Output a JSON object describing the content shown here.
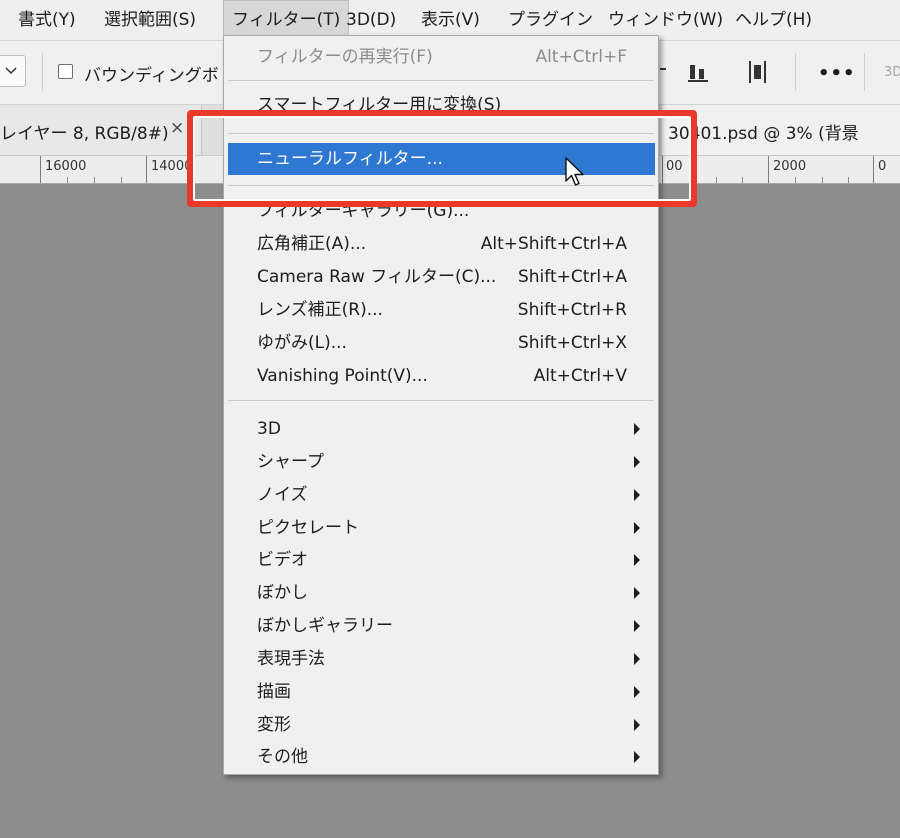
{
  "menubar": {
    "items": [
      "書式(Y)",
      "選択範囲(S)",
      "フィルター(T)",
      "3D(D)",
      "表示(V)",
      "プラグイン",
      "ウィンドウ(W)",
      "ヘルプ(H)"
    ]
  },
  "options": {
    "bounding_box_label": "バウンディングボ",
    "more_label": "•••",
    "three_d_label": "3D"
  },
  "tabs": {
    "left_title": "レイヤー 8, RGB/8#)",
    "left_close": "×",
    "right_title": "30401.psd @ 3% (背景"
  },
  "ruler": {
    "labels": [
      "16000",
      "14000",
      "00",
      "2000",
      "0"
    ]
  },
  "filter_menu": {
    "last_filter": {
      "label": "フィルターの再実行(F)",
      "shortcut": "Alt+Ctrl+F"
    },
    "smart_filter": {
      "label": "スマートフィルター用に変換(S)"
    },
    "neural_filters": {
      "label": "ニューラルフィルター..."
    },
    "filter_gallery": {
      "label": "フィルターギャラリー(G)..."
    },
    "adaptive_wide_angle": {
      "label": "広角補正(A)...",
      "shortcut": "Alt+Shift+Ctrl+A"
    },
    "camera_raw": {
      "label": "Camera Raw フィルター(C)...",
      "shortcut": "Shift+Ctrl+A"
    },
    "lens_correction": {
      "label": "レンズ補正(R)...",
      "shortcut": "Shift+Ctrl+R"
    },
    "liquify": {
      "label": "ゆがみ(L)...",
      "shortcut": "Shift+Ctrl+X"
    },
    "vanishing_point": {
      "label": "Vanishing Point(V)...",
      "shortcut": "Alt+Ctrl+V"
    },
    "submenus": [
      "3D",
      "シャープ",
      "ノイズ",
      "ピクセレート",
      "ビデオ",
      "ぼかし",
      "ぼかしギャラリー",
      "表現手法",
      "描画",
      "変形",
      "その他"
    ]
  },
  "colors": {
    "highlight": "#2f78d1",
    "callout": "#e8392b"
  }
}
